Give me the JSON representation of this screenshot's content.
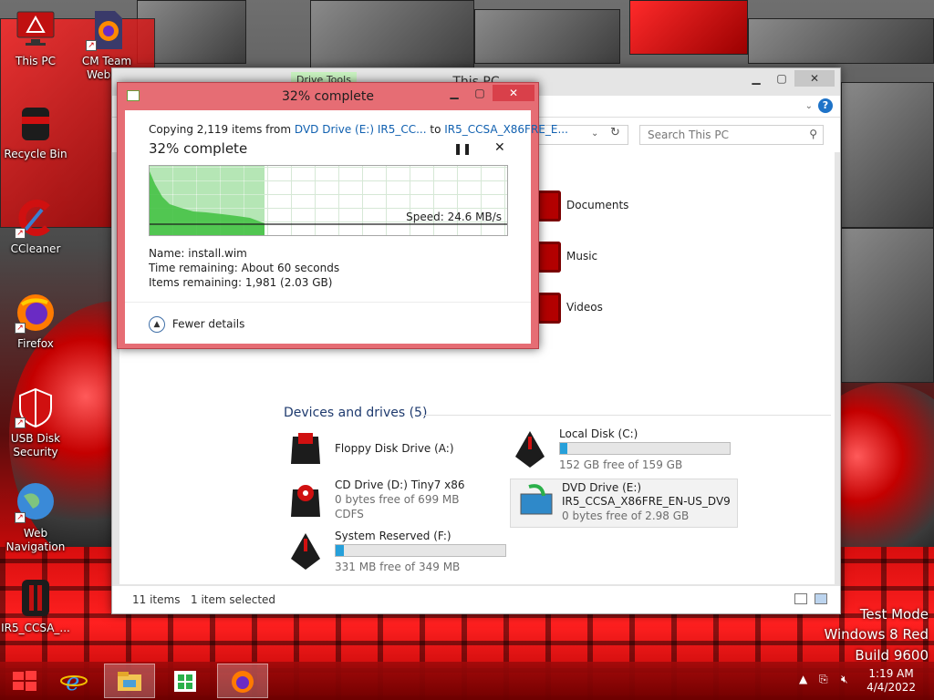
{
  "desktop": {
    "icons": [
      {
        "label": "This PC",
        "icon": "this-pc-icon"
      },
      {
        "label": "CM Team Webs...",
        "icon": "firefox-doc-icon"
      },
      {
        "label": "Recycle Bin",
        "icon": "recycle-bin-icon"
      },
      {
        "label": "CCleaner",
        "icon": "ccleaner-icon"
      },
      {
        "label": "Firefox",
        "icon": "firefox-icon"
      },
      {
        "label": "USB Disk Security",
        "icon": "shield-icon"
      },
      {
        "label": "Web Navigation",
        "icon": "globe-icon"
      },
      {
        "label": "IR5_CCSA_...",
        "icon": "drive-icon"
      }
    ],
    "watermark": [
      "Test Mode",
      "Windows 8 Red",
      "Build 9600"
    ]
  },
  "explorer": {
    "title": "This PC",
    "ribbon_tab": "Drive Tools",
    "search_placeholder": "Search This PC",
    "folders": [
      "Documents",
      "Music",
      "Videos"
    ],
    "section": "Devices and drives (5)",
    "drives": [
      {
        "name": "Floppy Disk Drive (A:)"
      },
      {
        "name": "Local Disk (C:)",
        "usage": "152 GB free of 159 GB",
        "used_fraction": 0.045
      },
      {
        "name": "CD Drive (D:) Tiny7 x86",
        "line2": "0 bytes free of 699 MB",
        "fs": "CDFS"
      },
      {
        "name": "DVD Drive (E:)",
        "line2": "IR5_CCSA_X86FRE_EN-US_DV9",
        "usage": "0 bytes free of 2.98 GB"
      },
      {
        "name": "System Reserved (F:)",
        "usage": "331 MB free of 349 MB",
        "used_fraction": 0.05
      }
    ],
    "status": {
      "items": "11 items",
      "selected": "1 item selected"
    }
  },
  "copy": {
    "title": "32% complete",
    "prefix": "Copying 2,119 items from",
    "source": "DVD Drive (E:) IR5_CC...",
    "to": "to",
    "dest": "IR5_CCSA_X86FRE_E...",
    "percent_text": "32% complete",
    "percent": 32,
    "speed": "Speed: 24.6 MB/s",
    "name_label": "Name:",
    "name_value": "install.wim",
    "time_label": "Time remaining:",
    "time_value": "About 60 seconds",
    "items_label": "Items remaining:",
    "items_value": "1,981 (2.03 GB)",
    "fewer": "Fewer details"
  },
  "taskbar": {
    "apps": [
      {
        "icon": "windows-logo-icon"
      },
      {
        "icon": "internet-explorer-icon"
      },
      {
        "icon": "file-explorer-icon",
        "active": true
      },
      {
        "icon": "store-icon"
      },
      {
        "icon": "firefox-icon",
        "active": true
      }
    ],
    "time": "1:19 AM",
    "date": "4/4/2022"
  },
  "colors": {
    "accent_red": "#e66d74",
    "progress_green": "#78d278",
    "drive_bar": "#26a0da",
    "link": "#1060b0"
  }
}
